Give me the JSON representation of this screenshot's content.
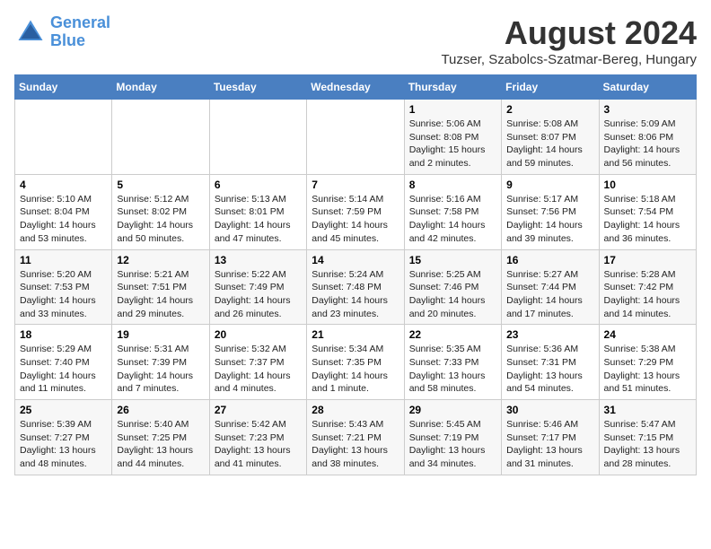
{
  "header": {
    "logo_line1": "General",
    "logo_line2": "Blue",
    "month_year": "August 2024",
    "location": "Tuzser, Szabolcs-Szatmar-Bereg, Hungary"
  },
  "days_of_week": [
    "Sunday",
    "Monday",
    "Tuesday",
    "Wednesday",
    "Thursday",
    "Friday",
    "Saturday"
  ],
  "weeks": [
    [
      {
        "day": "",
        "info": ""
      },
      {
        "day": "",
        "info": ""
      },
      {
        "day": "",
        "info": ""
      },
      {
        "day": "",
        "info": ""
      },
      {
        "day": "1",
        "info": "Sunrise: 5:06 AM\nSunset: 8:08 PM\nDaylight: 15 hours\nand 2 minutes."
      },
      {
        "day": "2",
        "info": "Sunrise: 5:08 AM\nSunset: 8:07 PM\nDaylight: 14 hours\nand 59 minutes."
      },
      {
        "day": "3",
        "info": "Sunrise: 5:09 AM\nSunset: 8:06 PM\nDaylight: 14 hours\nand 56 minutes."
      }
    ],
    [
      {
        "day": "4",
        "info": "Sunrise: 5:10 AM\nSunset: 8:04 PM\nDaylight: 14 hours\nand 53 minutes."
      },
      {
        "day": "5",
        "info": "Sunrise: 5:12 AM\nSunset: 8:02 PM\nDaylight: 14 hours\nand 50 minutes."
      },
      {
        "day": "6",
        "info": "Sunrise: 5:13 AM\nSunset: 8:01 PM\nDaylight: 14 hours\nand 47 minutes."
      },
      {
        "day": "7",
        "info": "Sunrise: 5:14 AM\nSunset: 7:59 PM\nDaylight: 14 hours\nand 45 minutes."
      },
      {
        "day": "8",
        "info": "Sunrise: 5:16 AM\nSunset: 7:58 PM\nDaylight: 14 hours\nand 42 minutes."
      },
      {
        "day": "9",
        "info": "Sunrise: 5:17 AM\nSunset: 7:56 PM\nDaylight: 14 hours\nand 39 minutes."
      },
      {
        "day": "10",
        "info": "Sunrise: 5:18 AM\nSunset: 7:54 PM\nDaylight: 14 hours\nand 36 minutes."
      }
    ],
    [
      {
        "day": "11",
        "info": "Sunrise: 5:20 AM\nSunset: 7:53 PM\nDaylight: 14 hours\nand 33 minutes."
      },
      {
        "day": "12",
        "info": "Sunrise: 5:21 AM\nSunset: 7:51 PM\nDaylight: 14 hours\nand 29 minutes."
      },
      {
        "day": "13",
        "info": "Sunrise: 5:22 AM\nSunset: 7:49 PM\nDaylight: 14 hours\nand 26 minutes."
      },
      {
        "day": "14",
        "info": "Sunrise: 5:24 AM\nSunset: 7:48 PM\nDaylight: 14 hours\nand 23 minutes."
      },
      {
        "day": "15",
        "info": "Sunrise: 5:25 AM\nSunset: 7:46 PM\nDaylight: 14 hours\nand 20 minutes."
      },
      {
        "day": "16",
        "info": "Sunrise: 5:27 AM\nSunset: 7:44 PM\nDaylight: 14 hours\nand 17 minutes."
      },
      {
        "day": "17",
        "info": "Sunrise: 5:28 AM\nSunset: 7:42 PM\nDaylight: 14 hours\nand 14 minutes."
      }
    ],
    [
      {
        "day": "18",
        "info": "Sunrise: 5:29 AM\nSunset: 7:40 PM\nDaylight: 14 hours\nand 11 minutes."
      },
      {
        "day": "19",
        "info": "Sunrise: 5:31 AM\nSunset: 7:39 PM\nDaylight: 14 hours\nand 7 minutes."
      },
      {
        "day": "20",
        "info": "Sunrise: 5:32 AM\nSunset: 7:37 PM\nDaylight: 14 hours\nand 4 minutes."
      },
      {
        "day": "21",
        "info": "Sunrise: 5:34 AM\nSunset: 7:35 PM\nDaylight: 14 hours\nand 1 minute."
      },
      {
        "day": "22",
        "info": "Sunrise: 5:35 AM\nSunset: 7:33 PM\nDaylight: 13 hours\nand 58 minutes."
      },
      {
        "day": "23",
        "info": "Sunrise: 5:36 AM\nSunset: 7:31 PM\nDaylight: 13 hours\nand 54 minutes."
      },
      {
        "day": "24",
        "info": "Sunrise: 5:38 AM\nSunset: 7:29 PM\nDaylight: 13 hours\nand 51 minutes."
      }
    ],
    [
      {
        "day": "25",
        "info": "Sunrise: 5:39 AM\nSunset: 7:27 PM\nDaylight: 13 hours\nand 48 minutes."
      },
      {
        "day": "26",
        "info": "Sunrise: 5:40 AM\nSunset: 7:25 PM\nDaylight: 13 hours\nand 44 minutes."
      },
      {
        "day": "27",
        "info": "Sunrise: 5:42 AM\nSunset: 7:23 PM\nDaylight: 13 hours\nand 41 minutes."
      },
      {
        "day": "28",
        "info": "Sunrise: 5:43 AM\nSunset: 7:21 PM\nDaylight: 13 hours\nand 38 minutes."
      },
      {
        "day": "29",
        "info": "Sunrise: 5:45 AM\nSunset: 7:19 PM\nDaylight: 13 hours\nand 34 minutes."
      },
      {
        "day": "30",
        "info": "Sunrise: 5:46 AM\nSunset: 7:17 PM\nDaylight: 13 hours\nand 31 minutes."
      },
      {
        "day": "31",
        "info": "Sunrise: 5:47 AM\nSunset: 7:15 PM\nDaylight: 13 hours\nand 28 minutes."
      }
    ]
  ]
}
